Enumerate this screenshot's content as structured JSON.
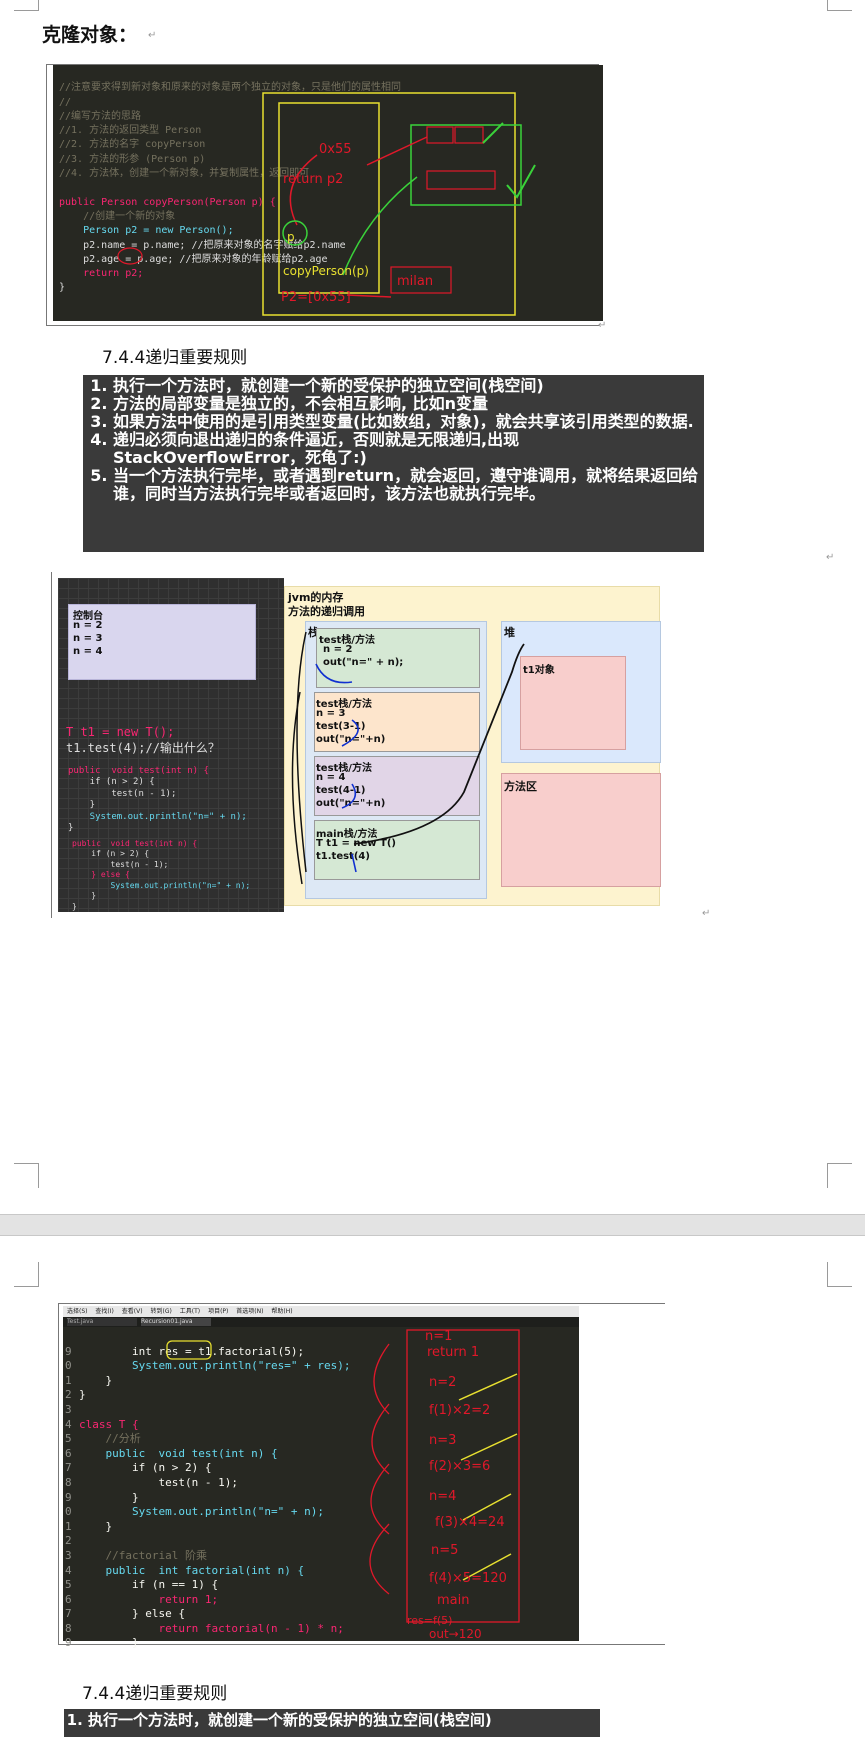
{
  "page1": {
    "heading": "克隆对象：",
    "code_block": {
      "lines": [
        "//注意要求得到新对象和原来的对象是两个独立的对象，只是他们的属性相同",
        "//",
        "//编写方法的思路",
        "//1. 方法的返回类型 Person",
        "//2. 方法的名字 copyPerson",
        "//3. 方法的形参 (Person p)",
        "//4. 方法体，创建一个新对象，并复制属性，返回即可",
        "",
        "public Person copyPerson(Person p) {",
        "    //创建一个新的对象",
        "    Person p2 = new Person();",
        "    p2.name = p.name; //把原来对象的名字赋给p2.name",
        "    p2.age = p.age; //把原来对象的年龄赋给p2.age",
        "    return p2;",
        "}"
      ],
      "annotations": [
        "0x55",
        "return p2",
        "p",
        "copyPerson(p)",
        "P2=[0x55]",
        "milan"
      ]
    },
    "section_title": "7.4.4递归重要规则",
    "rules": [
      "执行一个方法时，就创建一个新的受保护的独立空间(栈空间)",
      "方法的局部变量是独立的，不会相互影响, 比如n变量",
      "如果方法中使用的是引用类型变量(比如数组，对象)，就会共享该引用类型的数据.",
      "递归必须向退出递归的条件逼近，否则就是无限递归,出现StackOverflowError，死龟了:)",
      "当一个方法执行完毕，或者遇到return，就会返回，遵守谁调用，就将结果返回给谁，同时当方法执行完毕或者返回时，该方法也就执行完毕。"
    ],
    "diagram": {
      "console_title": "控制台",
      "console_lines": [
        "n = 2",
        "n = 3",
        "n = 4"
      ],
      "call_line1": "T t1 = new T();",
      "call_line2": "t1.test(4);//输出什么？",
      "code1": [
        "public  void test(int n) {",
        "    if (n > 2) {",
        "        test(n - 1);",
        "    }",
        "    System.out.println(\"n=\" + n);",
        "}"
      ],
      "code2": [
        "public  void test(int n) {",
        "    if (n > 2) {",
        "        test(n - 1);",
        "    } else {",
        "        System.out.println(\"n=\" + n);",
        "    }",
        "}"
      ],
      "jvm_title1": "jvm的内存",
      "jvm_title2": "方法的递归调用",
      "stack_label": "栈",
      "heap_label": "堆",
      "method_area_label": "方法区",
      "heap_object": "t1对象",
      "frames": [
        {
          "title": "test栈/方法",
          "lines": [
            "n = 2",
            "out(\"n=\" + n);"
          ]
        },
        {
          "title": "test栈/方法",
          "lines": [
            "n = 3",
            "test(3-1)",
            "out(\"n=\"+n)"
          ]
        },
        {
          "title": "test栈/方法",
          "lines": [
            "n = 4",
            "test(4-1)",
            "out(\"n=\"+n)"
          ]
        },
        {
          "title": "main栈/方法",
          "lines": [
            "T t1 = new T()",
            "t1.test(4)"
          ]
        }
      ]
    }
  },
  "page2": {
    "ide_menu": [
      "选择(S)",
      "查找(I)",
      "查看(V)",
      "转到(G)",
      "工具(T)",
      "项目(P)",
      "首选项(N)",
      "帮助(H)"
    ],
    "ide_tabs": [
      "Test.java",
      "Recursion01.java"
    ],
    "code_lines": [
      {
        "num": "9",
        "text": "        int res = t1.factorial(5);"
      },
      {
        "num": "0",
        "text": "        System.out.println(\"res=\" + res);"
      },
      {
        "num": "1",
        "text": "    }"
      },
      {
        "num": "2",
        "text": "}"
      },
      {
        "num": "3",
        "text": ""
      },
      {
        "num": "4",
        "text": "class T {"
      },
      {
        "num": "5",
        "text": "    //分析"
      },
      {
        "num": "6",
        "text": "    public  void test(int n) {"
      },
      {
        "num": "7",
        "text": "        if (n > 2) {"
      },
      {
        "num": "8",
        "text": "            test(n - 1);"
      },
      {
        "num": "9",
        "text": "        }"
      },
      {
        "num": "0",
        "text": "        System.out.println(\"n=\" + n);"
      },
      {
        "num": "1",
        "text": "    }"
      },
      {
        "num": "2",
        "text": ""
      },
      {
        "num": "3",
        "text": "    //factorial 阶乘"
      },
      {
        "num": "4",
        "text": "    public  int factorial(int n) {"
      },
      {
        "num": "5",
        "text": "        if (n == 1) {"
      },
      {
        "num": "6",
        "text": "            return 1;"
      },
      {
        "num": "7",
        "text": "        } else {"
      },
      {
        "num": "8",
        "text": "            return factorial(n - 1) * n;"
      },
      {
        "num": "9",
        "text": "        }"
      }
    ],
    "handwritten": [
      "n=1",
      "return 1",
      "n=2",
      "f(1)×2=2",
      "n=3",
      "f(2)×3=6",
      "n=4",
      "f(3)×4=24",
      "n=5",
      "f(4)×5=120",
      "main",
      "res=f(5)",
      "out→120"
    ],
    "section_title": "7.4.4递归重要规则",
    "rule_visible": "执行一个方法时，就创建一个新的受保护的独立空间(栈空间)"
  },
  "colors": {
    "code_bg": "#272822",
    "keyword": "#f92672",
    "type": "#66d9ef",
    "comment": "#75715e",
    "annotation_red": "#e0182a",
    "annotation_yellow": "#e8e030",
    "annotation_green": "#3ad23a"
  }
}
